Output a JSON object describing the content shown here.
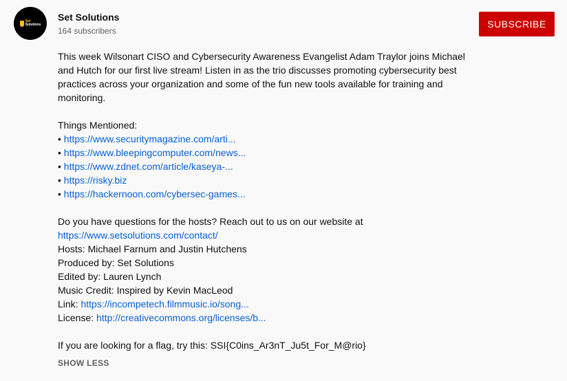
{
  "channel": {
    "avatar_top": "Set",
    "avatar_bottom": "Solutions",
    "name": "Set Solutions",
    "subscribers": "164 subscribers"
  },
  "subscribe_label": "SUBSCRIBE",
  "description": {
    "intro_lines": [
      "This week Wilsonart CISO and Cybersecurity Awareness Evangelist Adam Traylor joins Michael",
      "and Hutch for our first live stream! Listen in as the trio discusses promoting cybersecurity best",
      "practices across your organization and some of the fun new tools available for training and",
      "monitoring."
    ],
    "things_mentioned": "Things Mentioned:",
    "bullet": "•",
    "links": [
      "https://www.securitymagazine.com/arti...",
      "https://www.bleepingcomputer.com/news...",
      "https://www.zdnet.com/article/kaseya-...",
      "https://risky.biz",
      "https://hackernoon.com/cybersec-games..."
    ],
    "questions": "Do you have questions for the hosts? Reach out to us on our website at",
    "contact_link": "https://www.setsolutions.com/contact/",
    "hosts": "Hosts: Michael Farnum and Justin Hutchens",
    "produced": "Produced by: Set Solutions",
    "edited": "Edited by: Lauren Lynch",
    "music": "Music Credit: Inspired by Kevin MacLeod",
    "link_label": "Link:",
    "link_url": "https://incompetech.filmmusic.io/song...",
    "license_label": "License:",
    "license_url": "http://creativecommons.org/licenses/b...",
    "flag": "If you are looking for a flag, try this: SSI{C0ins_Ar3nT_Ju5t_For_M@rio}"
  },
  "show_less": "SHOW LESS"
}
